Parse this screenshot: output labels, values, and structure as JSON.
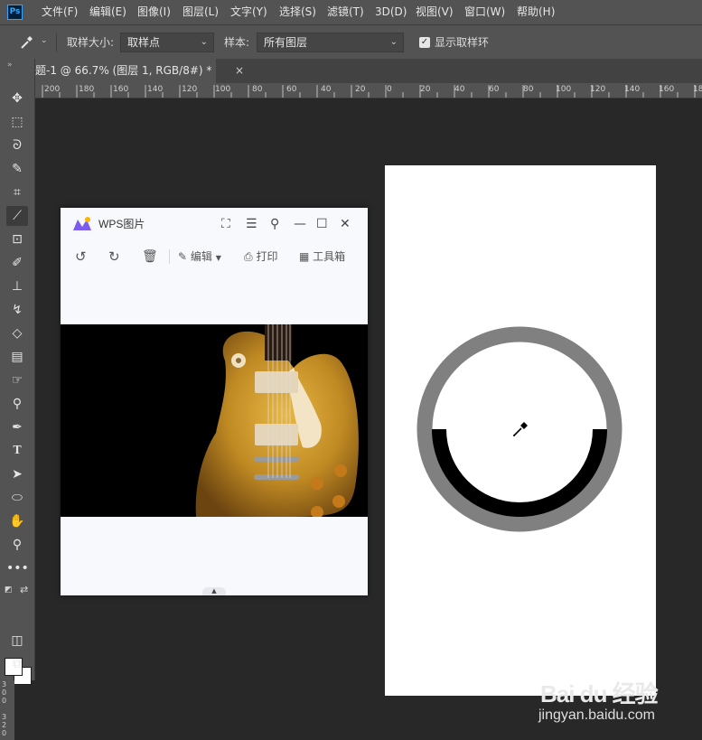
{
  "app": {
    "logo": "Ps",
    "menu": [
      "文件(F)",
      "编辑(E)",
      "图像(I)",
      "图层(L)",
      "文字(Y)",
      "选择(S)",
      "滤镜(T)",
      "3D(D)",
      "视图(V)",
      "窗口(W)",
      "帮助(H)"
    ]
  },
  "options": {
    "sample_size_label": "取样大小:",
    "sample_size_value": "取样点",
    "sample_label": "样本:",
    "sample_value": "所有图层",
    "show_ring_label": "显示取样环",
    "show_ring_checked": true
  },
  "document": {
    "tab_title": "题-1 @ 66.7% (图层 1, RGB/8#) *",
    "close_glyph": "×"
  },
  "ruler": {
    "labels": [
      "200",
      "180",
      "160",
      "140",
      "120",
      "100",
      "80",
      "60",
      "40",
      "20",
      "0",
      "20",
      "40",
      "60",
      "80",
      "100",
      "120",
      "140",
      "160",
      "18"
    ]
  },
  "vruler": [
    "3",
    "0",
    "0",
    "3",
    "2",
    "0"
  ],
  "wps": {
    "title": "WPS图片",
    "toolbar": {
      "edit": "编辑",
      "print": "打印",
      "toolbox": "工具箱"
    }
  },
  "colors": {
    "ring_gray": "#808080",
    "ring_black": "#000000",
    "canvas": "#ffffff",
    "workspace": "#282828",
    "panel": "#535353"
  },
  "watermark": {
    "logo": "Bai du 经验",
    "url": "jingyan.baidu.com"
  }
}
